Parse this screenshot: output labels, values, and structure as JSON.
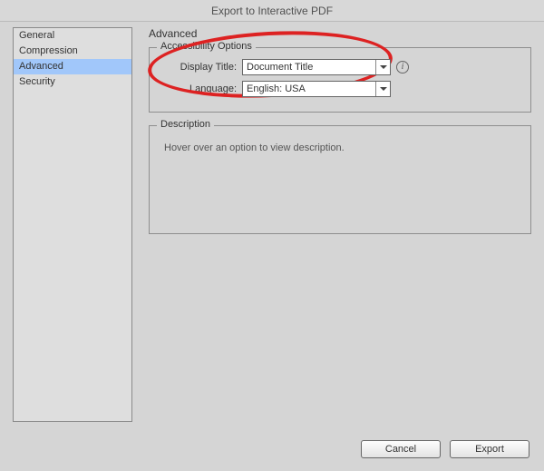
{
  "window": {
    "title": "Export to Interactive PDF"
  },
  "sidebar": {
    "items": [
      "General",
      "Compression",
      "Advanced",
      "Security"
    ],
    "selected_index": 2
  },
  "panel": {
    "title": "Advanced",
    "accessibility": {
      "legend": "Accessibility Options",
      "display_title_label": "Display Title:",
      "display_title_value": "Document Title",
      "language_label": "Language:",
      "language_value": "English: USA"
    },
    "description": {
      "legend": "Description",
      "text": "Hover over an option to view description."
    }
  },
  "buttons": {
    "cancel": "Cancel",
    "export": "Export"
  }
}
